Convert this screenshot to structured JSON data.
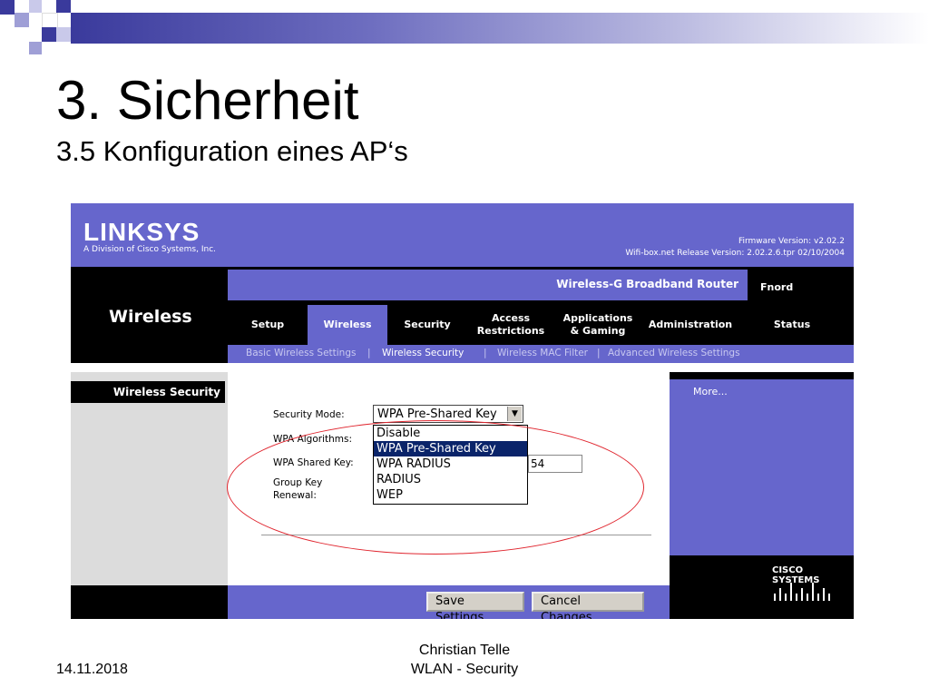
{
  "slide": {
    "title": "3. Sicherheit",
    "subtitle": "3.5  Konfiguration eines AP‘s",
    "date": "14.11.2018",
    "author": "Christian Telle",
    "topic": "WLAN - Security",
    "accent": "#3a3a9c"
  },
  "router": {
    "brand": "LINKSYS",
    "brand_sub": "A Division of Cisco Systems, Inc.",
    "firmware": "Firmware Version: v2.02.2",
    "release": "Wifi-box.net Release Version: 2.02.2.6.tpr 02/10/2004",
    "product": "Wireless-G Broadband Router",
    "device_name": "Fnord",
    "section": "Wireless",
    "tabs": [
      "Setup",
      "Wireless",
      "Security",
      "Access\nRestrictions",
      "Applications\n& Gaming",
      "Administration",
      "Status"
    ],
    "active_tab": "Wireless",
    "subnav": [
      "Basic Wireless Settings",
      "|",
      "Wireless Security",
      "|",
      "Wireless MAC Filter",
      "|",
      "Advanced Wireless Settings"
    ],
    "section_label": "Wireless Security",
    "more_link": "More...",
    "fields": {
      "security_mode_label": "Security Mode:",
      "wpa_algorithms_label": "WPA Algorithms:",
      "wpa_shared_key_label": "WPA Shared Key:",
      "group_key_label_1": "Group Key",
      "group_key_label_2": "Renewal:",
      "security_mode_value": "WPA Pre-Shared Key",
      "shared_key_partial": "54"
    },
    "dropdown_options": [
      "Disable",
      "WPA Pre-Shared Key",
      "WPA RADIUS",
      "RADIUS",
      "WEP"
    ],
    "selected_option": "WPA Pre-Shared Key",
    "save_label": "Save Settings",
    "cancel_label": "Cancel Changes",
    "cisco": "CISCO SYSTEMS",
    "colors": {
      "primary": "#6666cc",
      "highlight": "#0a246a",
      "annotation": "#e0262f"
    }
  }
}
